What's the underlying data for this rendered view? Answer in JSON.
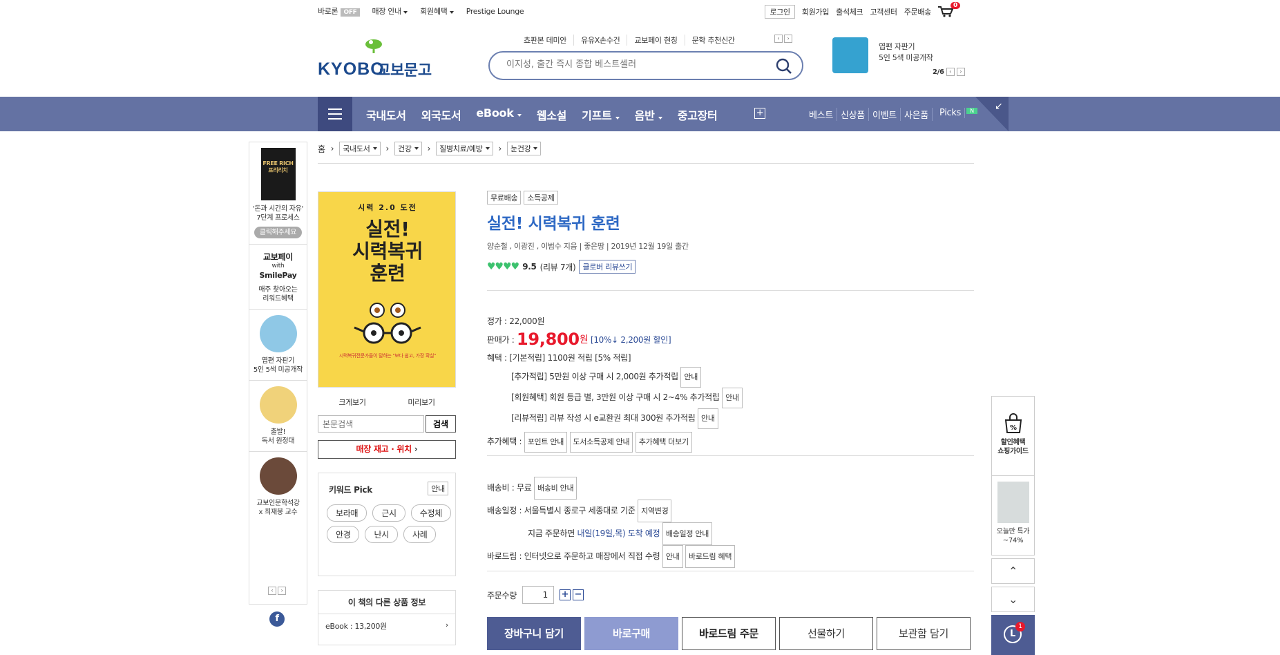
{
  "topbar": {
    "baro": "바로론",
    "baro_state": "OFF",
    "links": [
      "매장 안내",
      "회원혜택",
      "Prestige Lounge"
    ],
    "right": [
      "로그인",
      "회원가입",
      "출석체크",
      "고객센터",
      "주문배송"
    ],
    "cart_count": "0"
  },
  "logo": {
    "en": "KYOBO",
    "kr": "교보문고"
  },
  "hot_keywords": [
    "쵸판본 데미안",
    "유유X손수건",
    "교보페이 현칭",
    "문학 추천신간"
  ],
  "search": {
    "placeholder": "이지성, 출간 즉시 종합 베스트셀러"
  },
  "promo": {
    "line1": "엽편 자판기",
    "line2": "5인 5색 미공개작",
    "page": "2/6"
  },
  "nav": {
    "items": [
      "국내도서",
      "외국도서",
      "eBook",
      "웹소설",
      "기프트",
      "음반",
      "중고장터"
    ],
    "sub": [
      "베스트",
      "신상품",
      "이벤트",
      "사은품",
      "Picks"
    ],
    "new_badge": "N"
  },
  "left_side": {
    "book_title": "FREE RICH 프리리치",
    "book_caption1": "'돈과 시간의 자유'",
    "book_caption2": "7단계 프로세스",
    "click": "클릭해주세요",
    "pay1": "교보페이",
    "pay2": "with",
    "pay3": "SmilePay",
    "pay4": "매주 찾아오는",
    "pay5": "리워드혜택",
    "item3a": "엽편 자판기",
    "item3b": "5인 5색 미공개작",
    "item4a": "출발!",
    "item4b": "독서 원정대",
    "item5a": "교보인문학석강",
    "item5b": "x 최재붕 교수"
  },
  "breadcrumb": {
    "home": "홈",
    "levels": [
      "국내도서",
      "건강",
      "질병치료/예방",
      "눈건강"
    ]
  },
  "cover": {
    "series": "시력 2.0 도전",
    "title1": "실전!",
    "title2": "시력복귀",
    "title3": "훈련",
    "tag": "시력복귀전문가들이 말하는 \"보다 쉽고, 가장 확실\""
  },
  "cover_links": {
    "zoom": "크게보기",
    "preview": "미리보기"
  },
  "inbook_search": {
    "placeholder": "본문검색",
    "button": "검색"
  },
  "stock": "매장 재고 · 위치",
  "keyword_pick": {
    "title": "키워드 Pick",
    "info": "안내",
    "chips": [
      "보라매",
      "근시",
      "수정체",
      "안경",
      "난시",
      "사례"
    ]
  },
  "other_products": {
    "title": "이 책의 다른 상품 정보",
    "ebook": "eBook : 13,200원"
  },
  "product": {
    "badges": [
      "무료배송",
      "소득공제"
    ],
    "title": "실전! 시력복귀 훈련",
    "authors": "양순철 , 이광진 , 이범수 지음",
    "publisher": "좋은땅",
    "date": "2019년 12월 19일 출간",
    "rating": "9.5",
    "reviews": "(리뷰 7개)",
    "review_button": "클로버 리뷰쓰기"
  },
  "price": {
    "list_label": "정가 :",
    "list": "22,000원",
    "sale_label": "판매가 :",
    "sale": "19,800",
    "won": "원",
    "discount": "[10%↓ 2,200원 할인]",
    "benefit_label": "혜택 :",
    "benefit1": "[기본적립] 1100원 적립 [5% 적립]",
    "benefit2": "[추가적립] 5만원 이상 구매 시 2,000원 추가적립",
    "benefit3": "[회원혜택] 회원 등급 별, 3만원 이상 구매 시 2~4% 추가적립",
    "benefit4": "[리뷰적립] 리뷰 작성 시 e교환권 최대 300원 추가적립",
    "info": "안내",
    "extra_label": "추가혜택 :",
    "extra": [
      "포인트 안내",
      "도서소득공제 안내",
      "추가혜택 더보기"
    ]
  },
  "shipping": {
    "fee_label": "배송비 :",
    "fee": "무료",
    "fee_btn": "배송비 안내",
    "sched_label": "배송일정 :",
    "sched": "서울특별시 종로구 세종대로 기준",
    "region_btn": "지역변경",
    "order_now": "지금 주문하면",
    "arrival": "내일(19일,목) 도착 예정",
    "sched_btn": "배송일정 안내",
    "barodrim_label": "바로드림 :",
    "barodrim": "인터넷으로 주문하고 매장에서 직접 수령",
    "info": "안내",
    "barodrim_btn": "바로드림 혜택"
  },
  "quantity": {
    "label": "주문수량",
    "value": "1"
  },
  "actions": [
    "장바구니 담기",
    "바로구매",
    "바로드림 주문",
    "선물하기",
    "보관함 담기"
  ],
  "right_side": {
    "guide1": "할인혜택",
    "guide2": "쇼핑가이드",
    "deal1": "오늘만 특가",
    "deal2": "~74%",
    "recent_count": "1"
  }
}
